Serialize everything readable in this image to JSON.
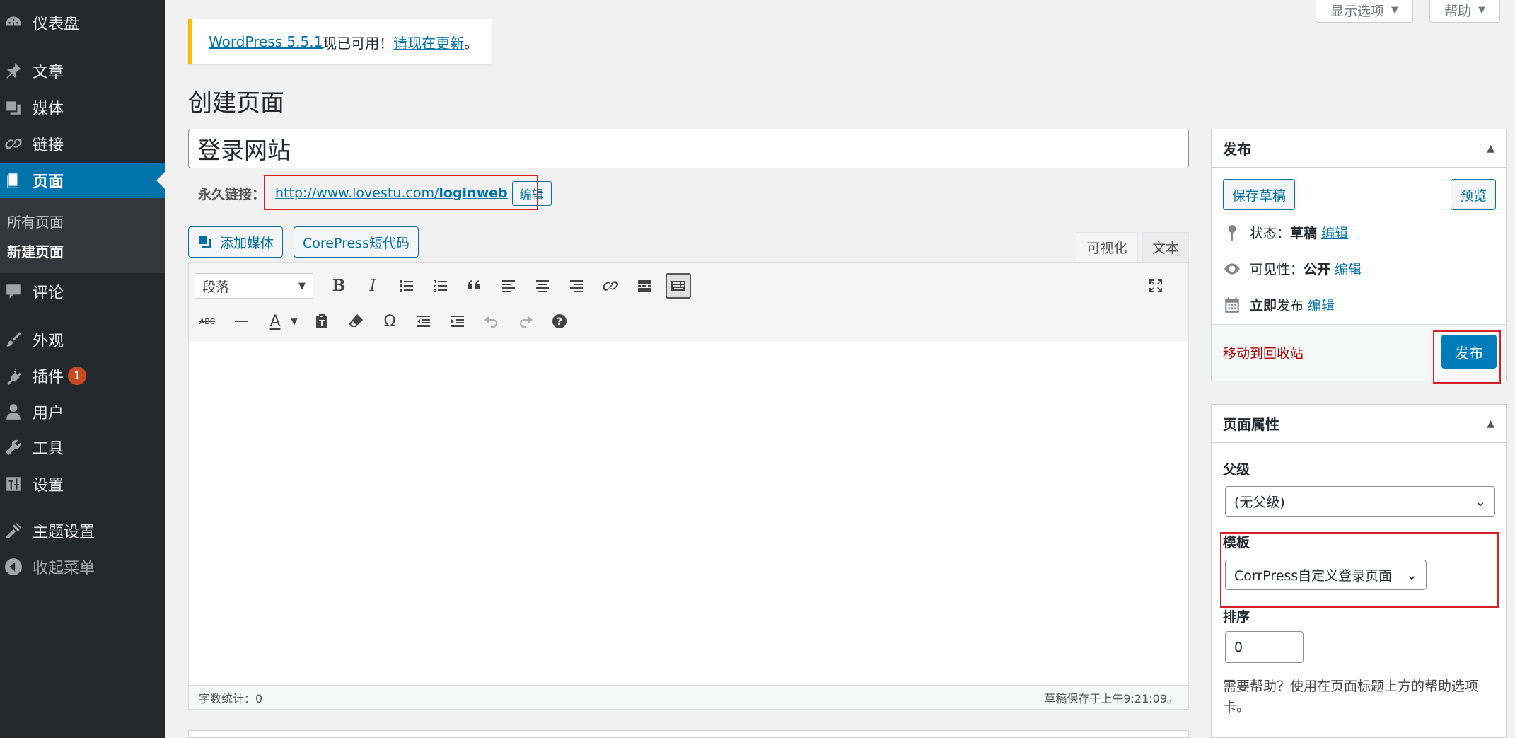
{
  "sidebar": {
    "items": [
      {
        "label": "仪表盘",
        "icon": "dashboard-icon"
      },
      {
        "label": "文章",
        "icon": "pin-icon"
      },
      {
        "label": "媒体",
        "icon": "media-icon"
      },
      {
        "label": "链接",
        "icon": "link-icon"
      },
      {
        "label": "页面",
        "icon": "page-icon"
      },
      {
        "label": "评论",
        "icon": "comment-icon"
      },
      {
        "label": "外观",
        "icon": "brush-icon"
      },
      {
        "label": "插件",
        "icon": "plugin-icon",
        "badge": "1"
      },
      {
        "label": "用户",
        "icon": "user-icon"
      },
      {
        "label": "工具",
        "icon": "wrench-icon"
      },
      {
        "label": "设置",
        "icon": "settings-icon"
      },
      {
        "label": "主题设置",
        "icon": "theme-settings-icon"
      },
      {
        "label": "收起菜单",
        "icon": "collapse-icon"
      }
    ],
    "submenu": [
      "所有页面",
      "新建页面"
    ]
  },
  "header": {
    "screen_options": "显示选项",
    "help": "帮助"
  },
  "notice": {
    "link1": "WordPress 5.5.1",
    "text": "现已可用！",
    "link2": "请现在更新",
    "end": "。"
  },
  "page_title": "创建页面",
  "post": {
    "title": "登录网站",
    "permalink_label": "永久链接：",
    "permalink_base": "http://www.lovestu.com/",
    "permalink_slug": "loginweb",
    "permalink_edit": "编辑"
  },
  "media_buttons": {
    "add_media": "添加媒体",
    "shortcode": "CorePress短代码"
  },
  "editor_tabs": {
    "visual": "可视化",
    "text": "文本"
  },
  "editor": {
    "format": "段落",
    "word_count": "字数统计：0",
    "saved": "草稿保存于上午9:21:09。"
  },
  "publish": {
    "title": "发布",
    "save_draft": "保存草稿",
    "preview": "预览",
    "status_label": "状态：",
    "status_value": "草稿",
    "visibility_label": "可见性：",
    "visibility_value": "公开",
    "publish_time_bold": "立即",
    "publish_time_rest": "发布",
    "edit": "编辑",
    "trash": "移动到回收站",
    "publish_button": "发布"
  },
  "page_attributes": {
    "title": "页面属性",
    "parent_label": "父级",
    "parent_value": "(无父级)",
    "template_label": "模板",
    "template_value": "CorrPress自定义登录页面",
    "order_label": "排序",
    "order_value": "0",
    "help_text": "需要帮助？使用在页面标题上方的帮助选项卡。"
  },
  "colors": {
    "accent": "#0073aa",
    "sidebar_bg": "#23282d",
    "highlight_box": "#d71f26",
    "notice_border": "#ffb900",
    "trash": "#a00"
  }
}
